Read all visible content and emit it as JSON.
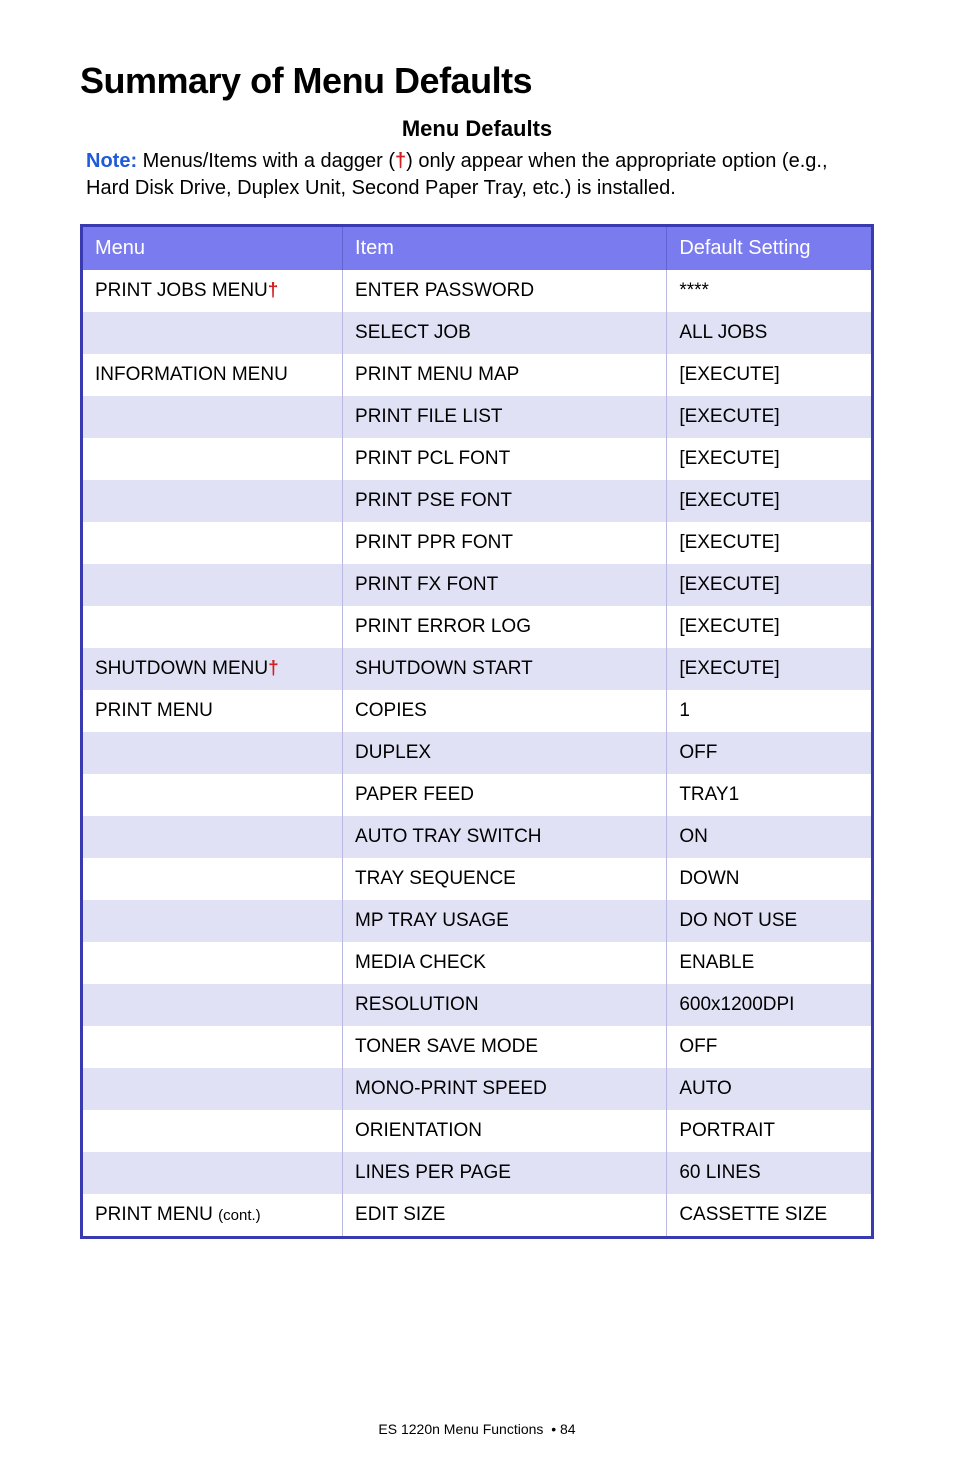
{
  "title": "Summary of Menu Defaults",
  "subtitle": "Menu Defaults",
  "note": {
    "label": "Note:",
    "before_dagger": " Menus/Items with a dagger (",
    "dagger": "†",
    "after_dagger": ") only appear when the appropriate option (e.g., Hard Disk Drive, Duplex Unit, Second Paper Tray, etc.) is installed."
  },
  "headers": {
    "menu": "Menu",
    "item": "Item",
    "default": "Default Setting"
  },
  "rows": [
    {
      "menu": "PRINT JOBS MENU",
      "menu_dagger": true,
      "item": "ENTER PASSWORD",
      "default": "****"
    },
    {
      "menu": "",
      "item": "SELECT JOB",
      "default": "ALL JOBS"
    },
    {
      "menu": "INFORMATION MENU",
      "item": "PRINT MENU MAP",
      "default": "[EXECUTE]"
    },
    {
      "menu": "",
      "item": "PRINT FILE LIST",
      "default": "[EXECUTE]"
    },
    {
      "menu": "",
      "item": "PRINT PCL FONT",
      "default": "[EXECUTE]"
    },
    {
      "menu": "",
      "item": "PRINT PSE FONT",
      "default": "[EXECUTE]"
    },
    {
      "menu": "",
      "item": "PRINT PPR FONT",
      "default": "[EXECUTE]"
    },
    {
      "menu": "",
      "item": "PRINT FX FONT",
      "default": "[EXECUTE]"
    },
    {
      "menu": "",
      "item": "PRINT ERROR LOG",
      "default": "[EXECUTE]"
    },
    {
      "menu": "SHUTDOWN MENU",
      "menu_dagger": true,
      "item": "SHUTDOWN START",
      "default": "[EXECUTE]"
    },
    {
      "menu": "PRINT MENU",
      "item": "COPIES",
      "default": "1"
    },
    {
      "menu": "",
      "item": "DUPLEX",
      "default": "OFF"
    },
    {
      "menu": "",
      "item": "PAPER FEED",
      "default": "TRAY1"
    },
    {
      "menu": "",
      "item": "AUTO TRAY SWITCH",
      "default": "ON"
    },
    {
      "menu": "",
      "item": "TRAY SEQUENCE",
      "default": "DOWN"
    },
    {
      "menu": "",
      "item": "MP TRAY USAGE",
      "default": "DO NOT USE"
    },
    {
      "menu": "",
      "item": "MEDIA CHECK",
      "default": "ENABLE"
    },
    {
      "menu": "",
      "item": "RESOLUTION",
      "default": "600x1200DPI"
    },
    {
      "menu": "",
      "item": "TONER SAVE MODE",
      "default": "OFF"
    },
    {
      "menu": "",
      "item": "MONO-PRINT SPEED",
      "default": "AUTO"
    },
    {
      "menu": "",
      "item": "ORIENTATION",
      "default": "PORTRAIT"
    },
    {
      "menu": "",
      "item": "LINES PER PAGE",
      "default": "60 LINES"
    },
    {
      "menu": "PRINT MENU ",
      "menu_cont": "(cont.)",
      "item": "EDIT SIZE",
      "default": "CASSETTE SIZE"
    }
  ],
  "footer": {
    "text": "ES 1220n Menu Functions",
    "bullet": "•",
    "page": "84"
  }
}
